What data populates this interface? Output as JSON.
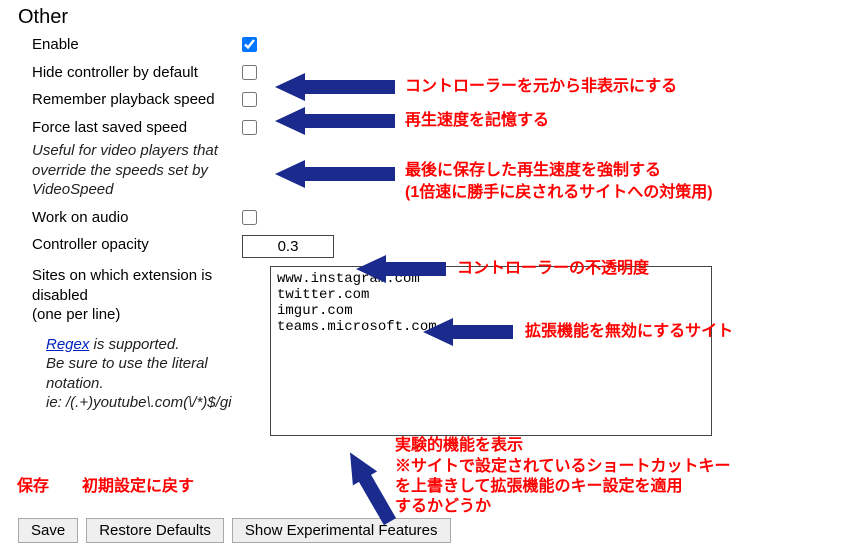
{
  "section_title": "Other",
  "rows": {
    "enable": {
      "label": "Enable",
      "checked": true
    },
    "hide_default": {
      "label": "Hide controller by default",
      "checked": false
    },
    "remember_speed": {
      "label": "Remember playback speed",
      "checked": false
    },
    "force_speed": {
      "label": "Force last saved speed",
      "hint": "Useful for video players that override the speeds set by VideoSpeed",
      "checked": false
    },
    "work_audio": {
      "label": "Work on audio",
      "checked": false
    },
    "opacity": {
      "label": "Controller opacity",
      "value": "0.3"
    },
    "disabled_sites": {
      "label": "Sites on which extension is disabled",
      "sublabel": "(one per line)",
      "value": "www.instagram.com\ntwitter.com\nimgur.com\nteams.microsoft.com"
    }
  },
  "regex_note": {
    "link_text": "Regex",
    "rest": " is supported.",
    "line2": "Be sure to use the literal notation.",
    "line3": "ie: /(.+)youtube\\.com(\\/*)$/gi"
  },
  "buttons": {
    "save": "Save",
    "restore": "Restore Defaults",
    "show_exp": "Show Experimental Features"
  },
  "annotations": {
    "a1": "コントローラーを元から非表示にする",
    "a2": "再生速度を記憶する",
    "a3_l1": "最後に保存した再生速度を強制する",
    "a3_l2": "(1倍速に勝手に戻されるサイトへの対策用)",
    "a4": "コントローラーの不透明度",
    "a5": "拡張機能を無効にするサイト",
    "a6_l1": "実験的機能を表示",
    "a6_l2": "※サイトで設定されているショートカットキー",
    "a6_l3": "を上書きして拡張機能のキー設定を適用",
    "a6_l4": "するかどうか",
    "save_label": "保存",
    "restore_label": "初期設定に戻す"
  }
}
